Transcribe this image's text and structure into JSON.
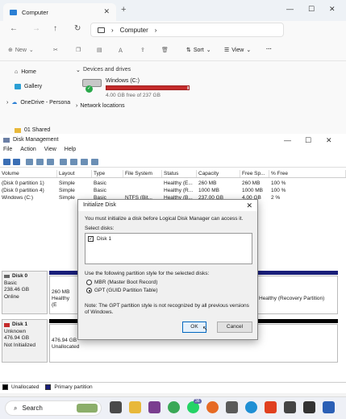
{
  "explorer": {
    "tab_title": "Computer",
    "address_path": "Computer",
    "cmd": {
      "new": "New",
      "sort": "Sort",
      "view": "View",
      "more": "···"
    },
    "sidebar": [
      {
        "label": "Home",
        "icon": "home-icon"
      },
      {
        "label": "Gallery",
        "icon": "gallery-icon"
      },
      {
        "label": "OneDrive - Persona",
        "icon": "cloud-icon"
      },
      {
        "label": "01 Shared",
        "icon": "folder-icon"
      }
    ],
    "devices_header": "Devices and drives",
    "drive": {
      "name": "Windows (C:)",
      "free": "4.00 GB free of 237 GB",
      "used_fraction": 0.983,
      "bar_color": "#c42b2b"
    },
    "network_locations": "Network locations"
  },
  "disk_management": {
    "title": "Disk Management",
    "menu": [
      "File",
      "Action",
      "View",
      "Help"
    ],
    "columns": [
      "Volume",
      "Layout",
      "Type",
      "File System",
      "Status",
      "Capacity",
      "Free Sp...",
      "% Free"
    ],
    "volumes": [
      [
        "(Disk 0 partition 1)",
        "Simple",
        "Basic",
        "",
        "Healthy (E...",
        "260 MB",
        "260 MB",
        "100 %"
      ],
      [
        "(Disk 0 partition 4)",
        "Simple",
        "Basic",
        "",
        "Healthy (R...",
        "1000 MB",
        "1000 MB",
        "100 %"
      ],
      [
        "Windows (C:)",
        "Simple",
        "Basic",
        "NTFS (Bit...",
        "Healthy (B...",
        "237.00 GB",
        "4.00 GB",
        "2 %"
      ]
    ],
    "disks": [
      {
        "name": "Disk 0",
        "type": "Basic",
        "size": "238.46 GB",
        "status": "Online",
        "part1_size": "260 MB",
        "part1_status": "Healthy (E",
        "part_last_status": "Healthy (Recovery Partition)"
      },
      {
        "name": "Disk 1",
        "type": "Unknown",
        "size": "476.94 GB",
        "status": "Not Initialized",
        "part_size": "476.94 GB",
        "part_status": "Unallocated"
      }
    ],
    "legend": [
      "Unallocated",
      "Primary partition"
    ]
  },
  "dialog": {
    "title": "Initialize Disk",
    "message": "You must initialize a disk before Logical Disk Manager can access it.",
    "select_label": "Select disks:",
    "disk_item": "Disk 1",
    "partition_prompt": "Use the following partition style for the selected disks:",
    "option_mbr": "MBR (Master Boot Record)",
    "option_gpt": "GPT (GUID Partition Table)",
    "note": "Note: The GPT partition style is not recognized by all previous versions of Windows.",
    "ok": "OK",
    "cancel": "Cancel"
  },
  "taskbar": {
    "search": "Search",
    "badge": "36"
  },
  "colors": {
    "accent": "#0067c0",
    "primary_partition": "#1a1f7a",
    "unallocated": "#000000"
  }
}
